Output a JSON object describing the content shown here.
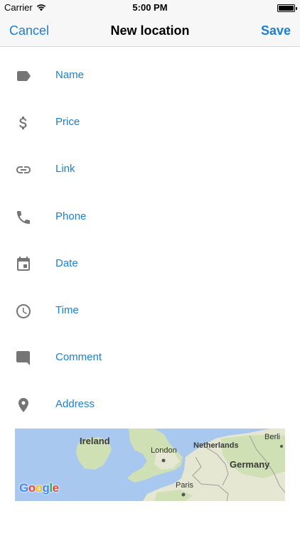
{
  "status_bar": {
    "carrier": "Carrier",
    "time": "5:00 PM",
    "icons": [
      "wifi-icon",
      "battery-icon"
    ]
  },
  "nav": {
    "cancel_label": "Cancel",
    "title": "New location",
    "save_label": "Save"
  },
  "form": {
    "fields": [
      {
        "label": "Name",
        "icon": "label-tag-icon"
      },
      {
        "label": "Price",
        "icon": "dollar-icon"
      },
      {
        "label": "Link",
        "icon": "link-icon"
      },
      {
        "label": "Phone",
        "icon": "phone-icon"
      },
      {
        "label": "Date",
        "icon": "calendar-icon"
      },
      {
        "label": "Time",
        "icon": "clock-icon"
      },
      {
        "label": "Comment",
        "icon": "comment-icon"
      },
      {
        "label": "Address",
        "icon": "location-pin-icon"
      }
    ]
  },
  "map": {
    "labels": {
      "ireland": "Ireland",
      "london": "London",
      "netherlands": "Netherlands",
      "berlin": "Berli",
      "germany": "Germany",
      "paris": "Paris"
    },
    "attribution": "Google",
    "colors": {
      "sea": "#a8c8f0",
      "land": "#e8ead4",
      "green": "#bcd9a4"
    }
  },
  "colors": {
    "accent": "#1a7fd4",
    "icon": "#757575",
    "bar_bg": "#f7f7f7"
  }
}
